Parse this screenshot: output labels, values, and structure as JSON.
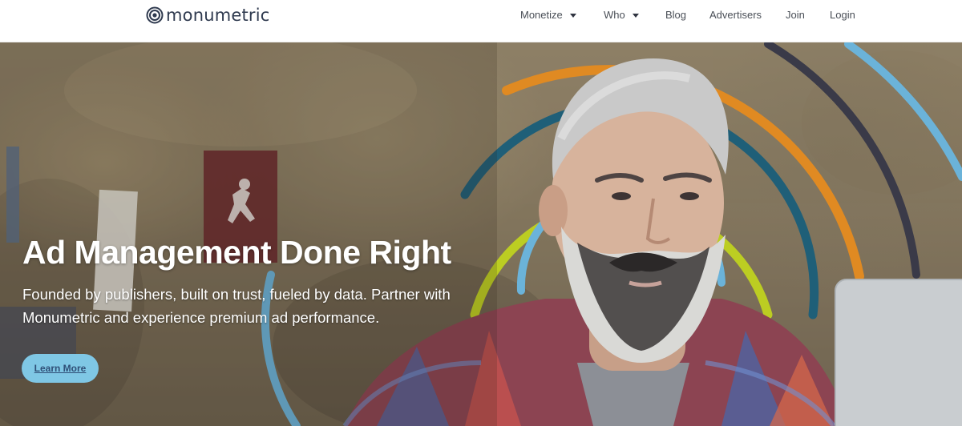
{
  "brand": {
    "logo_text": "monumetric",
    "logo_icon": "concentric-circles-logo-icon"
  },
  "nav": {
    "items": [
      {
        "label": "Monetize",
        "has_dropdown": true
      },
      {
        "label": "Who",
        "has_dropdown": true
      },
      {
        "label": "Blog",
        "has_dropdown": false
      },
      {
        "label": "Advertisers",
        "has_dropdown": false
      },
      {
        "label": "Join",
        "has_dropdown": false
      },
      {
        "label": "Login",
        "has_dropdown": false
      }
    ]
  },
  "hero": {
    "title": "Ad Management Done Right",
    "subtitle": "Founded by publishers, built on trust, fueled by data. Partner with Monumetric and experience premium ad performance.",
    "cta_label": "Learn More"
  },
  "colors": {
    "arc_orange": "#e08a22",
    "arc_teal": "#1f5f78",
    "arc_lime": "#bccd22",
    "arc_light_blue": "#6bb3d9",
    "arc_dark": "#3a3a48",
    "cta_bg": "#7fc7e5",
    "cta_text": "#2f4f77"
  }
}
